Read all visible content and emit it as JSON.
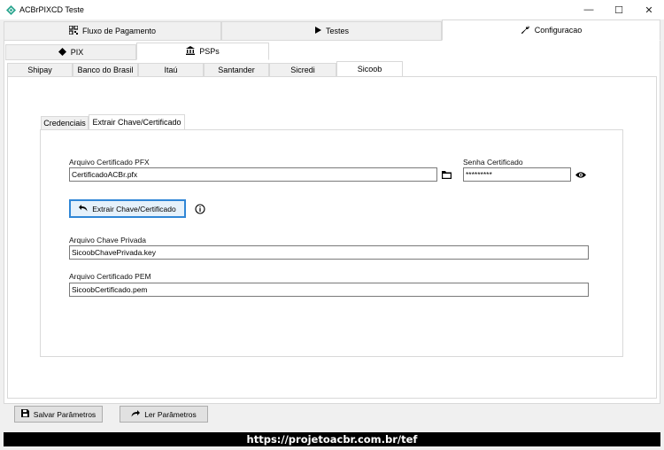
{
  "window": {
    "title": "ACBrPIXCD Teste",
    "minimize": "—",
    "maximize": "☐",
    "close": "✕"
  },
  "main_tabs": [
    {
      "label": "Fluxo de Pagamento",
      "icon": "qrcode-icon"
    },
    {
      "label": "Testes",
      "icon": "play-icon"
    },
    {
      "label": "Configuracao",
      "icon": "wrench-icon"
    }
  ],
  "config_tabs": [
    {
      "label": "PIX",
      "icon": "pix-diamond-icon"
    },
    {
      "label": "PSPs",
      "icon": "bank-icon"
    }
  ],
  "psp_tabs": [
    "Shipay",
    "Banco do Brasil",
    "Itaú",
    "Santander",
    "Sicredi",
    "Sicoob"
  ],
  "inner_tabs": [
    "Credenciais",
    "Extrair Chave/Certificado"
  ],
  "form": {
    "pfx_label": "Arquivo Certificado PFX",
    "pfx_value": "CertificadoACBr.pfx",
    "senha_label": "Senha Certificado",
    "senha_value": "*********",
    "extract_button": "Extrair Chave/Certificado",
    "chave_label": "Arquivo Chave Privada",
    "chave_value": "SicoobChavePrivada.key",
    "pem_label": "Arquivo Certificado PEM",
    "pem_value": "SicoobCertificado.pem"
  },
  "bottom": {
    "save_button": "Salvar Parâmetros",
    "read_button": "Ler Parâmetros"
  },
  "footer": {
    "url": "https://projetoacbr.com.br/tef"
  },
  "colors": {
    "accent": "#2f86d6",
    "app_icon": "#2aa58f"
  }
}
